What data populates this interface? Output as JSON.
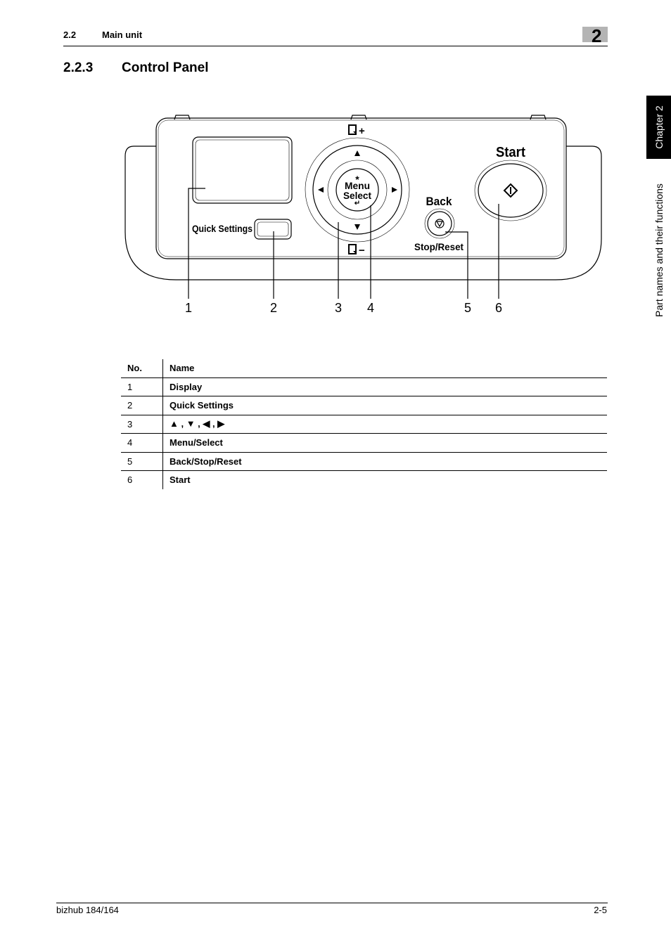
{
  "header": {
    "section_number": "2.2",
    "section_title": "Main unit",
    "chapter_digit": "2"
  },
  "section": {
    "number": "2.2.3",
    "title": "Control Panel"
  },
  "side_tab": {
    "chapter_label": "Chapter 2",
    "chapter_caption": "Part names and their functions"
  },
  "figure": {
    "panel_labels": {
      "quick_settings": "Quick Settings",
      "menu_line1": "Menu",
      "menu_line2": "Select",
      "back": "Back",
      "stop_reset": "Stop/Reset",
      "start": "Start",
      "zoom_plus": "+",
      "zoom_minus": "−"
    },
    "callouts": [
      "1",
      "2",
      "3",
      "4",
      "5",
      "6"
    ]
  },
  "table": {
    "headers": {
      "no": "No.",
      "name": "Name"
    },
    "rows": [
      {
        "no": "1",
        "name": "Display"
      },
      {
        "no": "2",
        "name": "Quick Settings"
      },
      {
        "no": "3",
        "name": "▲ , ▼ , ◀ , ▶"
      },
      {
        "no": "4",
        "name": "Menu/Select"
      },
      {
        "no": "5",
        "name": "Back/Stop/Reset"
      },
      {
        "no": "6",
        "name": "Start"
      }
    ]
  },
  "footer": {
    "model": "bizhub 184/164",
    "page": "2-5"
  }
}
